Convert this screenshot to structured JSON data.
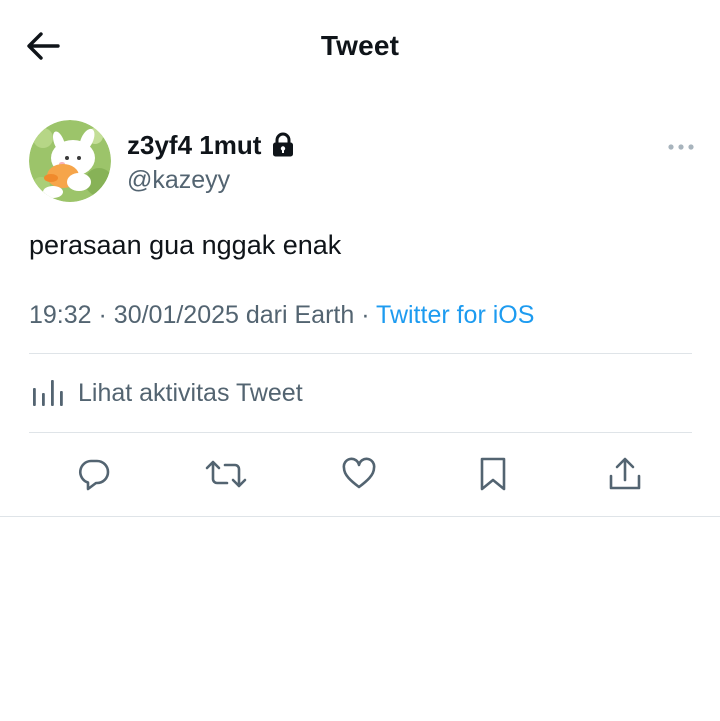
{
  "header": {
    "title": "Tweet",
    "back_icon": "arrow-left-icon"
  },
  "author": {
    "display_name": "z3yf4 1mut",
    "handle": "@kazeyy",
    "protected_icon": "lock-icon",
    "more_icon": "more-horizontal-icon"
  },
  "tweet": {
    "text": "perasaan gua nggak enak",
    "time": "19:32",
    "separator": "·",
    "date": "30/01/2025",
    "location": "dari Earth",
    "source": "Twitter for iOS"
  },
  "activity": {
    "label": "Lihat aktivitas Tweet",
    "icon": "bar-chart-icon"
  },
  "actions": {
    "reply_icon": "reply-icon",
    "retweet_icon": "retweet-icon",
    "like_icon": "heart-icon",
    "bookmark_icon": "bookmark-icon",
    "share_icon": "share-icon"
  },
  "colors": {
    "text": "#0f1419",
    "secondary": "#536471",
    "accent": "#1d9bf0",
    "divider": "#dfe4e8"
  }
}
